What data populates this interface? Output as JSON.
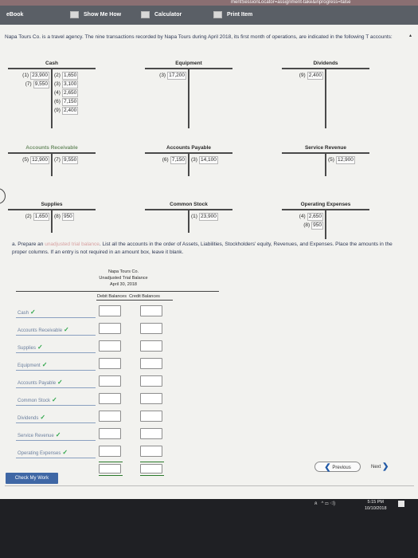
{
  "urlbar": {
    "text": "mentSessionLocator=assignment-take&inprogress=false"
  },
  "toolbar": {
    "ebook": "eBook",
    "show_me_how": "Show Me How",
    "calculator": "Calculator",
    "print_item": "Print Item"
  },
  "intro": "Napa Tours Co. is a travel agency. The nine transactions recorded by Napa Tours during April 2018, its first month of operations, are indicated in the following T accounts:",
  "t_accounts": {
    "cash": {
      "title": "Cash",
      "left": [
        {
          "label": "(1)",
          "value": "23,900"
        },
        {
          "label": "(7)",
          "value": "9,550"
        }
      ],
      "right": [
        {
          "label": "(2)",
          "value": "1,650"
        },
        {
          "label": "(3)",
          "value": "3,100"
        },
        {
          "label": "(4)",
          "value": "2,650"
        },
        {
          "label": "(6)",
          "value": "7,150"
        },
        {
          "label": "(9)",
          "value": "2,400"
        }
      ]
    },
    "equipment": {
      "title": "Equipment",
      "left": [
        {
          "label": "(3)",
          "value": "17,200"
        }
      ],
      "right": []
    },
    "dividends": {
      "title": "Dividends",
      "left": [
        {
          "label": "(9)",
          "value": "2,400"
        }
      ],
      "right": []
    },
    "accounts_receivable": {
      "title": "Accounts Receivable",
      "left": [
        {
          "label": "(5)",
          "value": "12,900"
        }
      ],
      "right": [
        {
          "label": "(7)",
          "value": "9,550"
        }
      ]
    },
    "accounts_payable": {
      "title": "Accounts Payable",
      "left": [
        {
          "label": "(6)",
          "value": "7,150"
        }
      ],
      "right": [
        {
          "label": "(3)",
          "value": "14,100"
        }
      ]
    },
    "service_revenue": {
      "title": "Service Revenue",
      "left": [],
      "right": [
        {
          "label": "(5)",
          "value": "12,900"
        }
      ]
    },
    "supplies": {
      "title": "Supplies",
      "left": [
        {
          "label": "(2)",
          "value": "1,650"
        }
      ],
      "right": [
        {
          "label": "(8)",
          "value": "950"
        }
      ]
    },
    "common_stock": {
      "title": "Common Stock",
      "left": [],
      "right": [
        {
          "label": "(1)",
          "value": "23,900"
        }
      ]
    },
    "operating_expenses": {
      "title": "Operating Expenses",
      "left": [
        {
          "label": "(4)",
          "value": "2,650"
        },
        {
          "label": "(8)",
          "value": "950"
        }
      ],
      "right": []
    }
  },
  "part_a": {
    "prefix": "a. Prepare an ",
    "highlight": "unadjusted trial balance",
    "rest": ". List all the accounts in the order of Assets, Liabilities, Stockholders' equity, Revenues, and Expenses. Place the amounts in the proper columns. If an entry is not required in an amount box, leave it blank."
  },
  "trial_balance": {
    "company": "Napa Tours Co.",
    "title": "Unadjusted Trial Balance",
    "date": "April 30, 2018",
    "debit_header": "Debit Balances",
    "credit_header": "Credit Balances",
    "rows": [
      {
        "account": "Cash",
        "check": "✓"
      },
      {
        "account": "Accounts Receivable",
        "check": "✓"
      },
      {
        "account": "Supplies",
        "check": "✓"
      },
      {
        "account": "Equipment",
        "check": "✓"
      },
      {
        "account": "Accounts Payable",
        "check": "✓"
      },
      {
        "account": "Common Stock",
        "check": "✓"
      },
      {
        "account": "Dividends",
        "check": "✓"
      },
      {
        "account": "Service Revenue",
        "check": "✓"
      },
      {
        "account": "Operating Expenses",
        "check": "✓"
      }
    ]
  },
  "nav": {
    "previous": "Previous",
    "next": "Next",
    "check_my_work": "Check My Work"
  },
  "taskbar": {
    "time": "5:15 PM",
    "date": "10/10/2018"
  },
  "icons": [
    "book-icon",
    "lightbulb-icon",
    "calculator-icon",
    "printer-icon",
    "chevron-left-icon",
    "chevron-right-icon",
    "checkmark-icon",
    "network-icon",
    "volume-icon",
    "notification-icon"
  ]
}
